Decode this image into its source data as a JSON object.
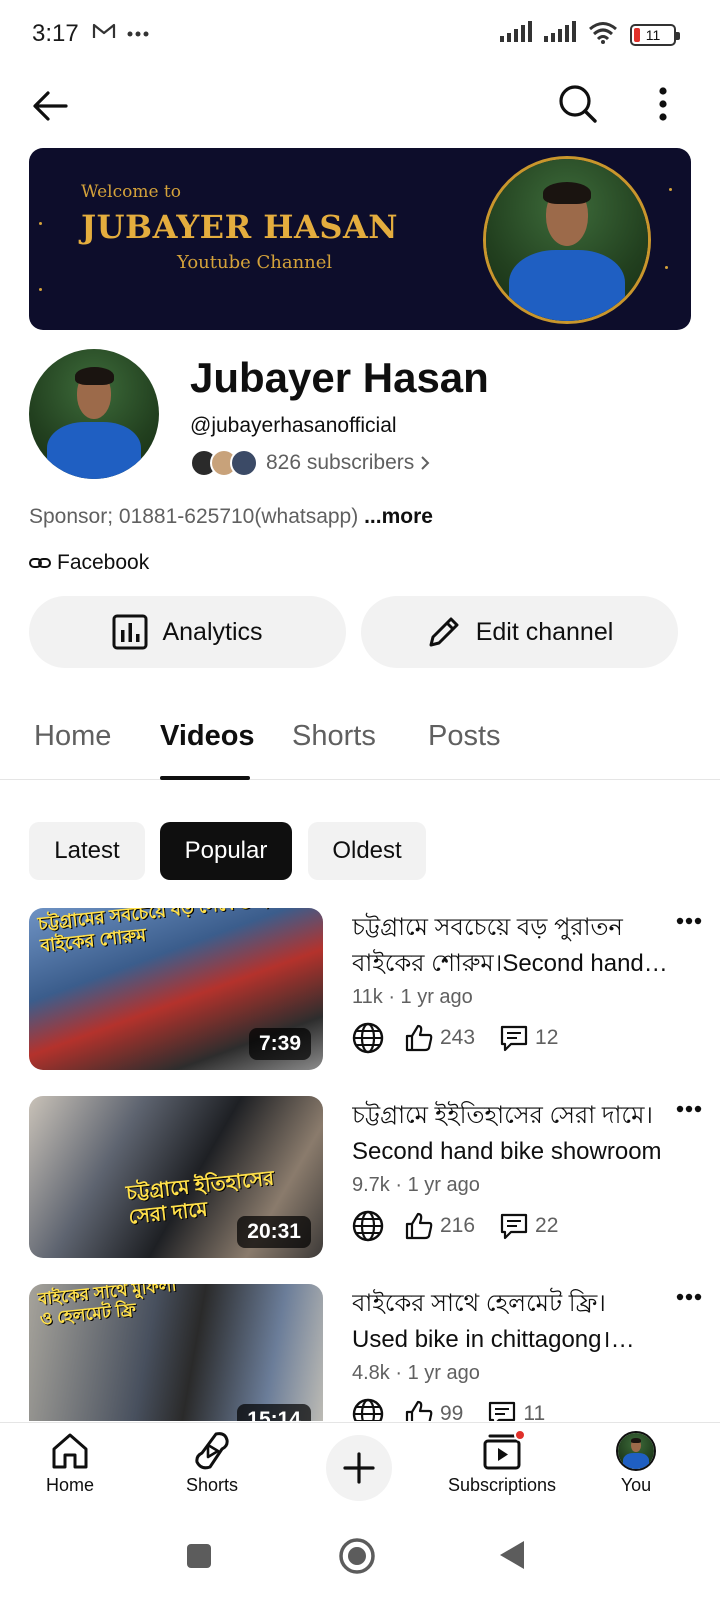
{
  "status_bar": {
    "time": "3:17",
    "battery": "11",
    "icons": [
      "gmail-icon",
      "more-dots-icon",
      "signal-icon",
      "signal-icon",
      "wifi-icon",
      "battery-icon"
    ]
  },
  "app_bar": {
    "icons": [
      "back-arrow-icon",
      "search-icon",
      "more-vert-icon"
    ]
  },
  "banner": {
    "welcome": "Welcome to",
    "name": "JUBAYER HASAN",
    "subtitle": "Youtube Channel"
  },
  "channel": {
    "name": "Jubayer Hasan",
    "handle": "@jubayerhasanofficial",
    "subscribers": "826 subscribers",
    "description": "Sponsor; 01881-625710(whatsapp)",
    "more_label": "...more",
    "link_label": "Facebook"
  },
  "actions": {
    "analytics": "Analytics",
    "edit": "Edit channel"
  },
  "tabs": [
    "Home",
    "Videos",
    "Shorts",
    "Posts"
  ],
  "active_tab": "Videos",
  "chips": [
    "Latest",
    "Popular",
    "Oldest"
  ],
  "active_chip": "Popular",
  "videos": [
    {
      "title": "চট্টগ্রামে সবচেয়ে বড় পুরাতন বাইকের শোরুম।Second hand bike showroom",
      "meta": "11k · 1 yr ago",
      "likes": "243",
      "comments": "12",
      "duration": "7:39",
      "thumb_text": "চট্টগ্রামের সবচেয়ে বড় সেকেন্ড হ্যান্ড বাইকের শোরুম"
    },
    {
      "title": "চট্টগ্রামে ইইতিহাসের সেরা দামে।Second hand bike showroom",
      "meta": "9.7k · 1 yr ago",
      "likes": "216",
      "comments": "22",
      "duration": "20:31",
      "thumb_text": "চট্টগ্রামে ইতিহাসের সেরা দামে"
    },
    {
      "title": "বাইকের সাথে হেলমেট ফ্রি। Used bike in chittagong। second hand bike",
      "meta": "4.8k · 1 yr ago",
      "likes": "99",
      "comments": "11",
      "duration": "15:14",
      "thumb_text": "বাইকের সাথে মুফিলা ও হেলমেট ফ্রি"
    }
  ],
  "bottom_nav": {
    "home": "Home",
    "shorts": "Shorts",
    "subscriptions": "Subscriptions",
    "you": "You"
  },
  "colors": {
    "accent_dark": "#0f0f0f",
    "chip_bg": "#f2f2f2",
    "banner_bg": "#0d0d2b",
    "banner_gold": "#e4ad3e",
    "notification_red": "#e0302a"
  }
}
